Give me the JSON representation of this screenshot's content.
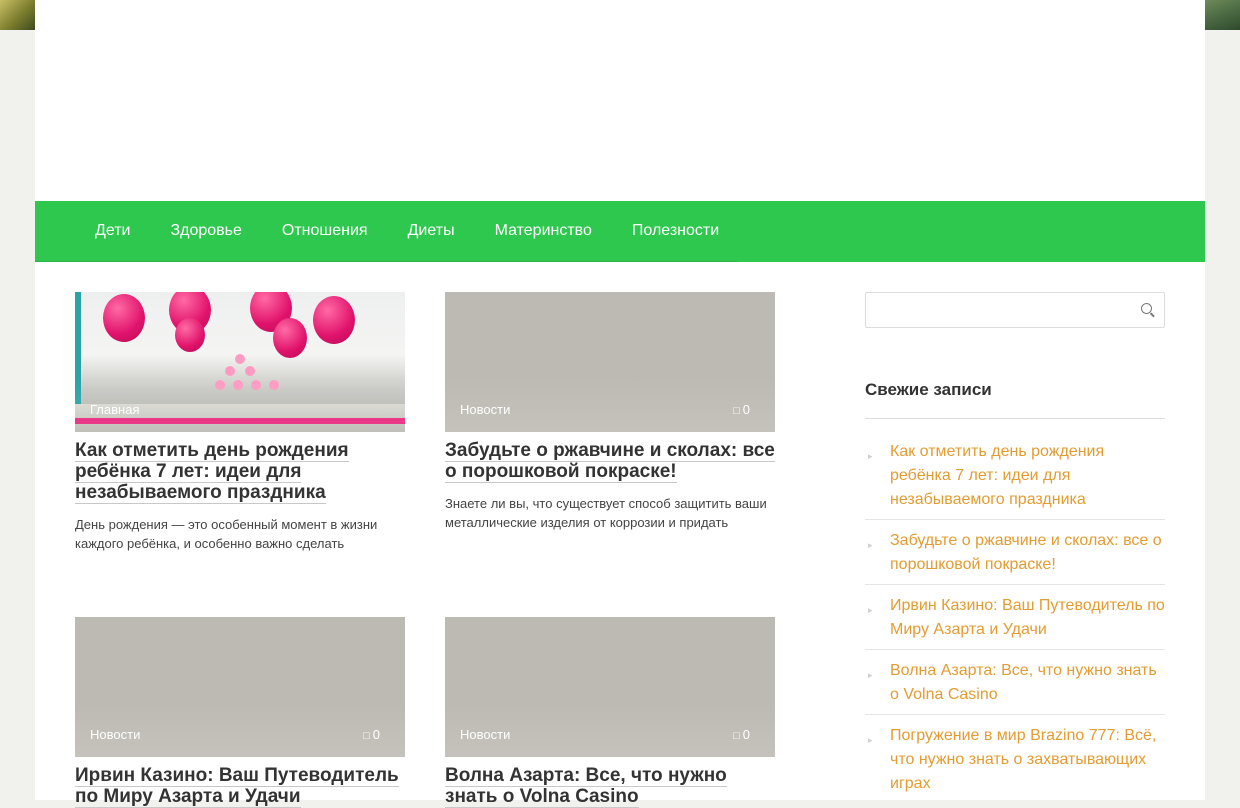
{
  "nav": {
    "items": [
      "Дети",
      "Здоровье",
      "Отношения",
      "Диеты",
      "Материнство",
      "Полезности"
    ]
  },
  "posts": [
    {
      "category": "Главная",
      "comments": "0",
      "title": "Как отметить день рождения ребёнка 7 лет: идеи для незабываемого праздника",
      "excerpt": "День рождения — это особенный момент в жизни каждого ребёнка, и особенно важно сделать"
    },
    {
      "category": "Новости",
      "comments": "0",
      "title": "Забудьте о ржавчине и сколах: все о порошковой покраске!",
      "excerpt": "Знаете ли вы, что существует способ защитить ваши металлические изделия от коррозии и придать"
    },
    {
      "category": "Новости",
      "comments": "0",
      "title": "Ирвин Казино: Ваш Путеводитель по Миру Азарта и Удачи",
      "excerpt": ""
    },
    {
      "category": "Новости",
      "comments": "0",
      "title": "Волна Азарта: Все, что нужно знать о Volna Casino",
      "excerpt": ""
    }
  ],
  "sidebar": {
    "search_placeholder": "",
    "recent_title": "Свежие записи",
    "recent": [
      "Как отметить день рождения ребёнка 7 лет: идеи для незабываемого праздника",
      "Забудьте о ржавчине и сколах: все о порошковой покраске!",
      "Ирвин Казино: Ваш Путеводитель по Миру Азарта и Удачи",
      "Волна Азарта: Все, что нужно знать о Volna Casino",
      "Погружение в мир Brazino 777: Всё, что нужно знать о захватывающих играх"
    ]
  },
  "colors": {
    "nav_bg": "#2dc84d",
    "link_accent": "#e39c31",
    "thumb_placeholder": "#bdbab3"
  }
}
